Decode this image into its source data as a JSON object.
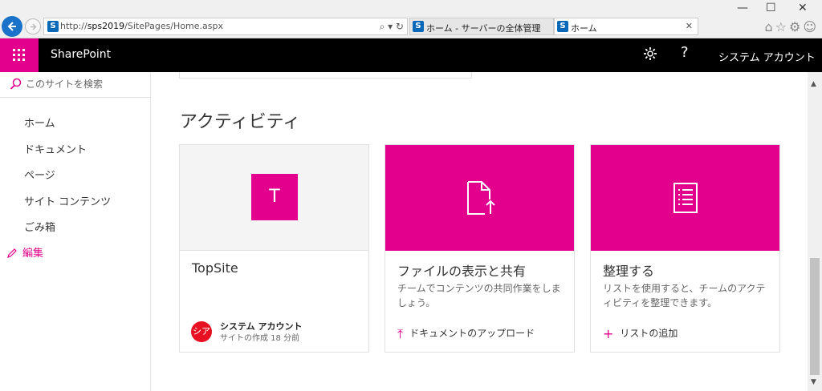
{
  "browser": {
    "url_prefix": "http://",
    "url_host": "sps2019",
    "url_path": "/SitePages/Home.aspx",
    "addr_tools": "⌕ ▾ ↻",
    "tabs": [
      {
        "label": "ホーム - サーバーの全体管理",
        "active": false
      },
      {
        "label": "ホーム",
        "active": true
      }
    ],
    "tab_close": "✕",
    "win_min": "—",
    "win_max": "☐",
    "win_close": "✕",
    "ie_tools": "⌂☆⚙☺"
  },
  "suitebar": {
    "brand": "SharePoint",
    "help": "?",
    "user": "システム アカウント",
    "user_caret": "▼"
  },
  "leftnav": {
    "search_placeholder": "このサイトを検索",
    "items": [
      "ホーム",
      "ドキュメント",
      "ページ",
      "サイト コンテンツ",
      "ごみ箱"
    ],
    "edit_label": "編集"
  },
  "main": {
    "section_title": "アクティビティ",
    "cards": [
      {
        "tile_letter": "T",
        "title": "TopSite",
        "owner_initials": "シア",
        "owner_name": "システム アカウント",
        "owner_meta": "サイトの作成 18 分前"
      },
      {
        "title": "ファイルの表示と共有",
        "desc": "チームでコンテンツの共同作業をしましょう。",
        "action_symbol": "⤒",
        "action": "ドキュメントのアップロード"
      },
      {
        "title": "整理する",
        "desc": "リストを使用すると、チームのアクティビティを整理できます。",
        "action_symbol": "+",
        "action": "リストの追加"
      }
    ]
  },
  "colors": {
    "accent": "#e3008c",
    "suitebar": "#000000",
    "browser_chrome": "#f0f0f0"
  }
}
